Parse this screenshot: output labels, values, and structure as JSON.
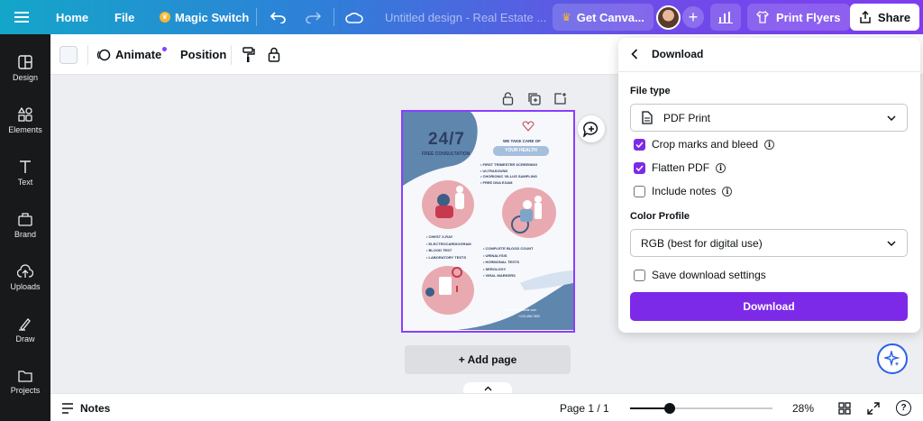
{
  "topbar": {
    "home": "Home",
    "file": "File",
    "magic_switch": "Magic Switch",
    "doc_title": "Untitled design - Real Estate ...",
    "get_canva": "Get Canva...",
    "print_flyers": "Print Flyers",
    "share": "Share"
  },
  "rail": [
    {
      "label": "Design",
      "icon": "design-icon"
    },
    {
      "label": "Elements",
      "icon": "elements-icon"
    },
    {
      "label": "Text",
      "icon": "text-icon"
    },
    {
      "label": "Brand",
      "icon": "brand-icon"
    },
    {
      "label": "Uploads",
      "icon": "uploads-icon"
    },
    {
      "label": "Draw",
      "icon": "draw-icon"
    },
    {
      "label": "Projects",
      "icon": "projects-icon"
    }
  ],
  "subbar": {
    "animate": "Animate",
    "position": "Position"
  },
  "flyer": {
    "headline": "24/7",
    "subhead": "FREE CONSULTATION",
    "tagline": "WE TAKE CARE OF",
    "tagline_badge": "YOUR HEALTH",
    "list1": [
      "FIRST TRIMESTER SCREENING",
      "ULTRASOUND",
      "CHORIONIC VILLUS SAMPLING",
      "FREE DNA EXAM"
    ],
    "list2": [
      "CHEST X-RAY",
      "ELECTROCARDIOGRAM",
      "BLOOD TEST",
      "LABORATORY TESTS"
    ],
    "list3": [
      "COMPLETE BLOOD COUNT",
      "URINALYSIS",
      "HORMONAL TESTS",
      "SEROLOGY",
      "VIRAL MARKERS"
    ],
    "email": "hello@reallygreatsite.com",
    "phone": "+123-456-7890"
  },
  "canvas": {
    "add_page": "+ Add page"
  },
  "bottombar": {
    "notes": "Notes",
    "page": "Page 1 / 1",
    "zoom": "28%",
    "zoom_fraction": 0.28,
    "help": "?"
  },
  "panel": {
    "title": "Download",
    "file_type_label": "File type",
    "file_type_value": "PDF Print",
    "options": [
      {
        "label": "Crop marks and bleed",
        "checked": true,
        "info": true
      },
      {
        "label": "Flatten PDF",
        "checked": true,
        "info": true
      },
      {
        "label": "Include notes",
        "checked": false,
        "info": true
      }
    ],
    "color_profile_label": "Color Profile",
    "color_profile_value": "RGB (best for digital use)",
    "save_settings": "Save download settings",
    "download_button": "Download"
  },
  "colors": {
    "accent": "#7d2ae8",
    "rail_bg": "#18191b",
    "flyer_blue": "#5f86ad",
    "flyer_pink": "#e8aab0"
  }
}
